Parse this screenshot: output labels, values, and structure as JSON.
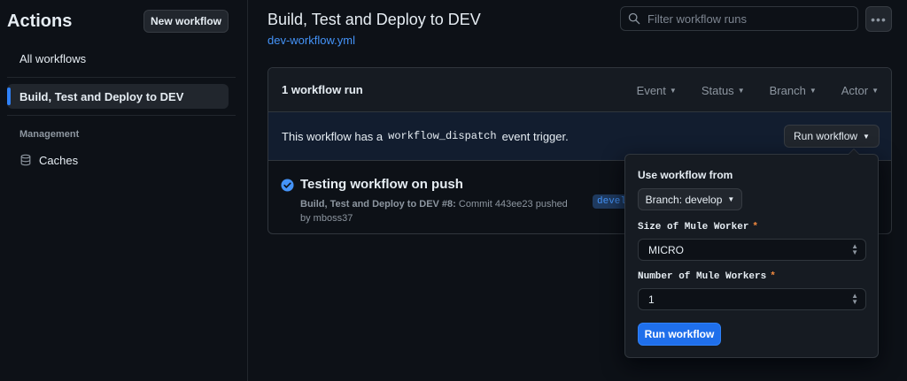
{
  "sidebar": {
    "title": "Actions",
    "new_workflow_label": "New workflow",
    "all_workflows_label": "All workflows",
    "active_workflow_label": "Build, Test and Deploy to DEV",
    "management_label": "Management",
    "caches_label": "Caches"
  },
  "header": {
    "title": "Build, Test and Deploy to DEV",
    "file_link": "dev-workflow.yml",
    "filter_placeholder": "Filter workflow runs",
    "more_icon": "kebab-horizontal-icon"
  },
  "runs": {
    "count_label": "1 workflow run",
    "filters": [
      "Event",
      "Status",
      "Branch",
      "Actor"
    ],
    "dispatch_prefix": "This workflow has a",
    "dispatch_code": "workflow_dispatch",
    "dispatch_suffix": "event trigger.",
    "run_workflow_label": "Run workflow",
    "items": [
      {
        "title": "Testing workflow on push",
        "workflow": "Build, Test and Deploy to DEV #8:",
        "detail": "Commit 443ee23 pushed",
        "actor_line": "by mboss37",
        "branch_tag": "devel",
        "status_icon": "check-circle-icon"
      }
    ]
  },
  "popover": {
    "heading": "Use workflow from",
    "branch_label": "Branch: develop",
    "fields": [
      {
        "label": "Size of Mule Worker",
        "required": "*",
        "value": "MICRO"
      },
      {
        "label": "Number of Mule Workers",
        "required": "*",
        "value": "1"
      }
    ],
    "submit_label": "Run workflow"
  },
  "colors": {
    "background": "#0d1117",
    "accent": "#2f81f7",
    "primary_button": "#1f6feb",
    "required": "#f0883e"
  }
}
